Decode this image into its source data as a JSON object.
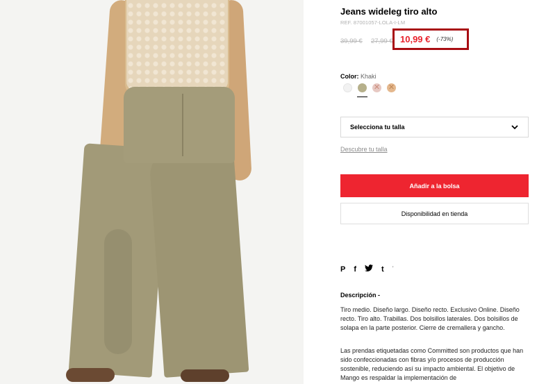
{
  "product": {
    "title": "Jeans wideleg tiro alto",
    "ref": "REF. 87001057-LOLA-I-LM",
    "original_price": "39,99 €",
    "previous_price": "27,99 €",
    "sale_price": "10,99 €",
    "discount": "(-73%)"
  },
  "color": {
    "label": "Color:",
    "value": "Khaki",
    "swatches": [
      {
        "name": "white",
        "color": "#f2f2f2",
        "available": true
      },
      {
        "name": "khaki",
        "color": "#b6b08b",
        "available": true,
        "selected": true
      },
      {
        "name": "pink",
        "color": "#e7c9c3",
        "available": false
      },
      {
        "name": "camel",
        "color": "#e4b88e",
        "available": false
      }
    ]
  },
  "size": {
    "select_label": "Selecciona tu talla",
    "guide_link": "Descubre tu talla"
  },
  "actions": {
    "add_to_bag": "Añadir a la bolsa",
    "store_availability": "Disponibilidad en tienda"
  },
  "share": {
    "icons": [
      "pinterest-icon",
      "facebook-icon",
      "twitter-icon",
      "tumblr-icon"
    ],
    "pinterest": "P",
    "facebook": "f",
    "twitter": "✓",
    "tumblr": "t",
    "more": "'"
  },
  "description": {
    "title": "Descripción -",
    "paragraph_1": "Tiro medio. Diseño largo. Diseño recto. Exclusivo Online. Diseño recto. Tiro alto. Trabillas. Dos bolsillos laterales. Dos bolsillos de solapa en la parte posterior. Cierre de cremallera y gancho.",
    "paragraph_2": "Las prendas etiquetadas como Committed son productos que han sido confeccionadas con fibras y/o procesos de producción sostenible, reduciendo así su impacto ambiental. El objetivo de Mango es respaldar la implementación de"
  },
  "colors": {
    "sale_red": "#e8232d",
    "button_red": "#ee2530",
    "highlight_border": "#a80d12"
  }
}
